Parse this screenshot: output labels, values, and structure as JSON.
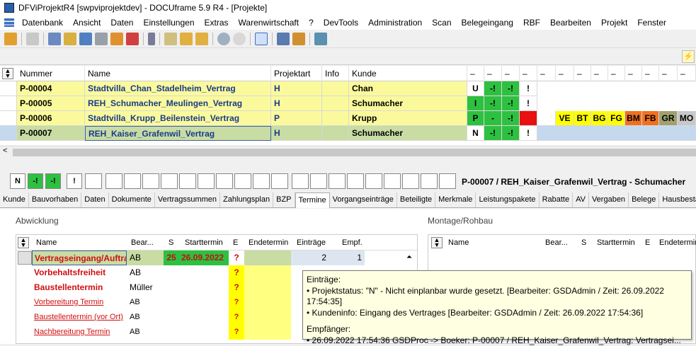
{
  "window": {
    "title": "DFViProjektR4 [swpviprojektdev] - DOCUframe 5.9 R4 - [Projekte]"
  },
  "menu": [
    "Datenbank",
    "Ansicht",
    "Daten",
    "Einstellungen",
    "Extras",
    "Warenwirtschaft",
    "?",
    "DevTools",
    "Administration",
    "Scan",
    "Belegeingang",
    "RBF",
    "Bearbeiten",
    "Projekt",
    "Fenster"
  ],
  "grid": {
    "headers": {
      "nummer": "Nummer",
      "name": "Name",
      "projektart": "Projektart",
      "info": "Info",
      "kunde": "Kunde",
      "dash": "–"
    },
    "rows": [
      {
        "nummer": "P-00004",
        "name": "Stadtvilla_Chan_Stadelheim_Vertrag",
        "art": "H",
        "kunde": "Chan",
        "s1": "U",
        "s2": "-!",
        "s3": "-!",
        "s4": "!"
      },
      {
        "nummer": "P-00005",
        "name": "REH_Schumacher_Meulingen_Vertrag",
        "art": "H",
        "kunde": "Schumacher",
        "s1": "I",
        "s2": "-!",
        "s3": "-!",
        "s4": "!"
      },
      {
        "nummer": "P-00006",
        "name": "Stadtvilla_Krupp_Beilenstein_Vertrag",
        "art": "P",
        "kunde": "Krupp",
        "s1": "P",
        "s2": "-",
        "s3": "-!",
        "s4": ""
      },
      {
        "nummer": "P-00007",
        "name": "REH_Kaiser_Grafenwil_Vertrag",
        "art": "H",
        "kunde": "Schumacher",
        "s1": "N",
        "s2": "-!",
        "s3": "-!",
        "s4": "!"
      }
    ],
    "badges": [
      "VE",
      "BT",
      "BG",
      "FG",
      "BM",
      "FB",
      "GR",
      "MO"
    ]
  },
  "status": {
    "boxes": [
      "N",
      "-!",
      "-!",
      "!"
    ],
    "project_label": "P-00007 / REH_Kaiser_Grafenwil_Vertrag - Schumacher"
  },
  "tabs": [
    "Kunde",
    "Bauvorhaben",
    "Daten",
    "Dokumente",
    "Vertragssummen",
    "Zahlungsplan",
    "BZP",
    "Termine",
    "Vorgangseinträge",
    "Beteiligte",
    "Merkmale",
    "Leistungspakete",
    "Rabatte",
    "AV",
    "Vergaben",
    "Belege",
    "Hausbestand"
  ],
  "abwicklung": {
    "title": "Abwicklung",
    "headers": {
      "name": "Name",
      "bear": "Bear...",
      "s": "S",
      "start": "Starttermin",
      "e": "E",
      "end": "Endetermin",
      "eintraege": "Einträge",
      "empf": "Empf."
    },
    "rows": [
      {
        "name": "Vertragseingang/Auftra",
        "bear": "AB",
        "s": "25",
        "start": "26.09.2022",
        "e": "?",
        "eintraege": "2",
        "empf": "1"
      },
      {
        "name": "Vorbehaltsfreiheit",
        "bear": "AB",
        "s": "",
        "start": "",
        "e": "?",
        "eintraege": "",
        "empf": ""
      },
      {
        "name": "Baustellentermin",
        "bear": "Müller",
        "s": "",
        "start": "",
        "e": "?",
        "eintraege": "",
        "empf": ""
      },
      {
        "name": "Vorbereitung Termin",
        "bear": "AB",
        "s": "",
        "start": "",
        "e": "?",
        "eintraege": "",
        "empf": ""
      },
      {
        "name": "Baustellentermin (vor Ort)",
        "bear": "AB",
        "s": "",
        "start": "",
        "e": "?",
        "eintraege": "",
        "empf": ""
      },
      {
        "name": "Nachbereitung Termin",
        "bear": "AB",
        "s": "",
        "start": "",
        "e": "?",
        "eintraege": "",
        "empf": ""
      }
    ]
  },
  "montage": {
    "title": "Montage/Rohbau",
    "headers": {
      "name": "Name",
      "bear": "Bear...",
      "s": "S",
      "start": "Starttermin",
      "e": "E",
      "end": "Endetermin"
    }
  },
  "tooltip": {
    "line1": "Einträge:",
    "line2": "• Projektstatus: \"N\" - Nicht einplanbar wurde gesetzt. [Bearbeiter: GSDAdmin / Zeit: 26.09.2022 17:54:35]",
    "line3": "• Kundeninfo: Eingang des Vertrages [Bearbeiter: GSDAdmin / Zeit: 26.09.2022 17:54:36]",
    "line4": "Empfänger:",
    "line5": "• 26.09.2022 17:54:36  GSDProc -> Boeker: P-00007 / REH_Kaiser_Grafenwil_Vertrag: Vertragsei..."
  }
}
